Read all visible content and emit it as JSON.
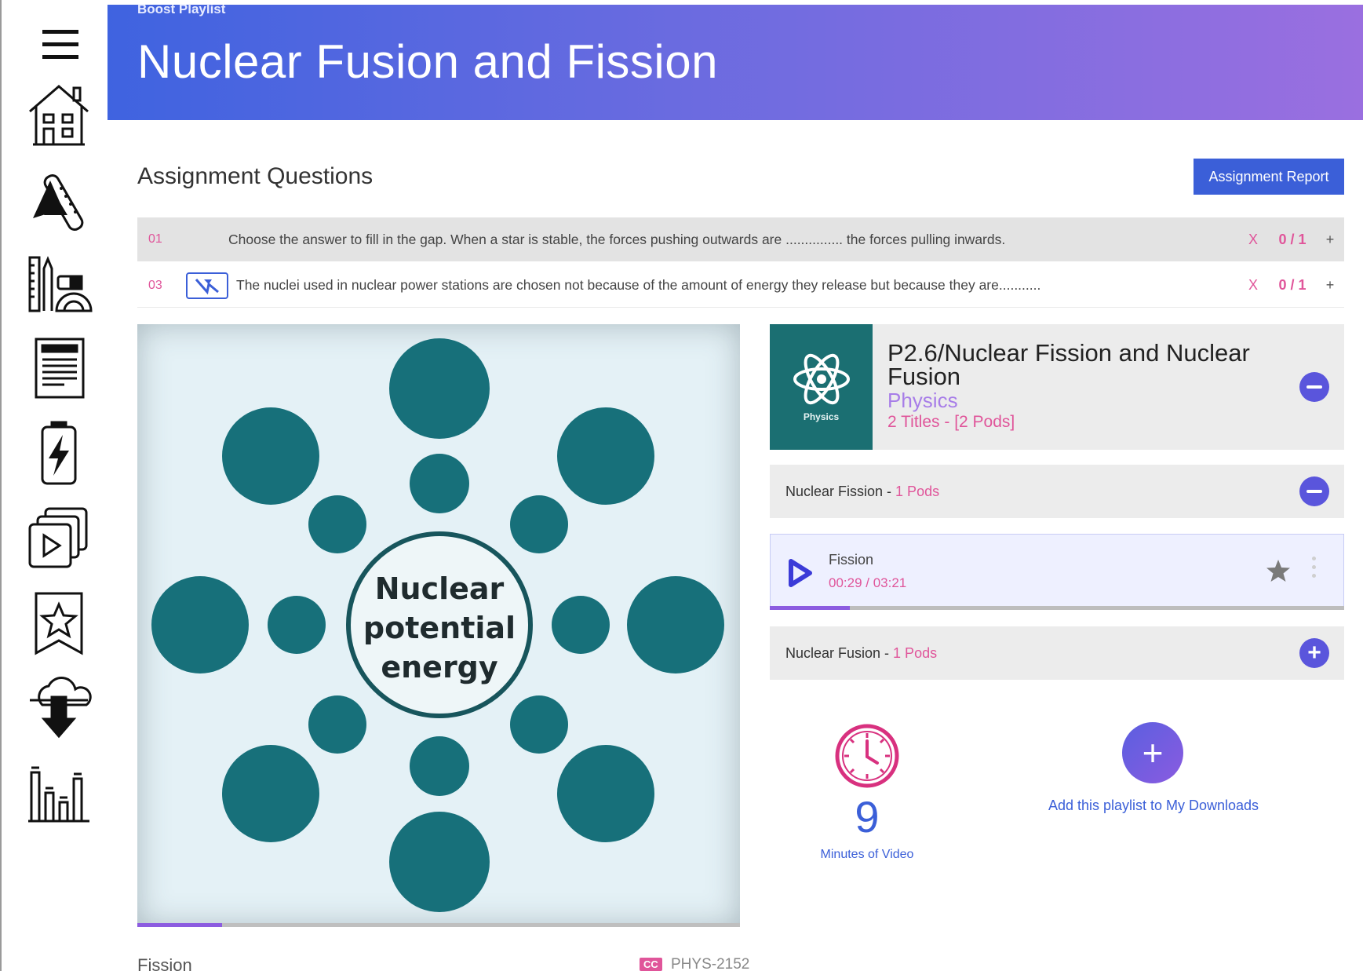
{
  "header": {
    "kicker": "Boost Playlist",
    "title": "Nuclear Fusion and Fission"
  },
  "sidebar": {
    "items": [
      {
        "icon": "menu-icon"
      },
      {
        "icon": "home-icon"
      },
      {
        "icon": "subjects-icon"
      },
      {
        "icon": "tools-icon"
      },
      {
        "icon": "worksheet-icon"
      },
      {
        "icon": "boost-icon"
      },
      {
        "icon": "video-library-icon"
      },
      {
        "icon": "bookmark-icon"
      },
      {
        "icon": "download-icon"
      },
      {
        "icon": "stats-icon"
      }
    ]
  },
  "assignment": {
    "title": "Assignment Questions",
    "report_button": "Assignment Report",
    "questions": [
      {
        "number": "01",
        "text": "Choose the answer to fill in the gap. When a star is stable, the forces pushing outwards are ............... the forces pulling inwards.",
        "mark": "X",
        "score": "0 / 1",
        "action": "+"
      },
      {
        "number": "03",
        "text": "The nuclei used in nuclear power stations are chosen not because of the amount of energy they release but because they are...........",
        "mark": "X",
        "score": "0 / 1",
        "action": "+"
      }
    ]
  },
  "video": {
    "center_text_1": "Nuclear",
    "center_text_2": "potential",
    "center_text_3": "energy",
    "caption": "Fission",
    "cc": "CC",
    "code": "PHYS-2152",
    "progress": 0.14
  },
  "playlist": {
    "thumb_label": "Physics",
    "title": "P2.6/Nuclear Fission and Nuclear Fusion",
    "subject": "Physics",
    "count": "2 Titles - [2 Pods]",
    "sections": [
      {
        "name": "Nuclear Fission - ",
        "pods": "1 Pods",
        "expanded": true
      },
      {
        "name": "Nuclear Fusion - ",
        "pods": "1 Pods",
        "expanded": false
      }
    ],
    "current_video": {
      "name": "Fission",
      "time": "00:29 / 03:21",
      "progress": 0.14
    }
  },
  "stats": {
    "minutes": "9",
    "minutes_label": "Minutes of Video",
    "download_label": "Add this playlist to My Downloads"
  },
  "colors": {
    "accent": "#3b5fd8",
    "pink": "#e0559a",
    "purple": "#8c5ce0",
    "teal": "#1b6f72"
  }
}
